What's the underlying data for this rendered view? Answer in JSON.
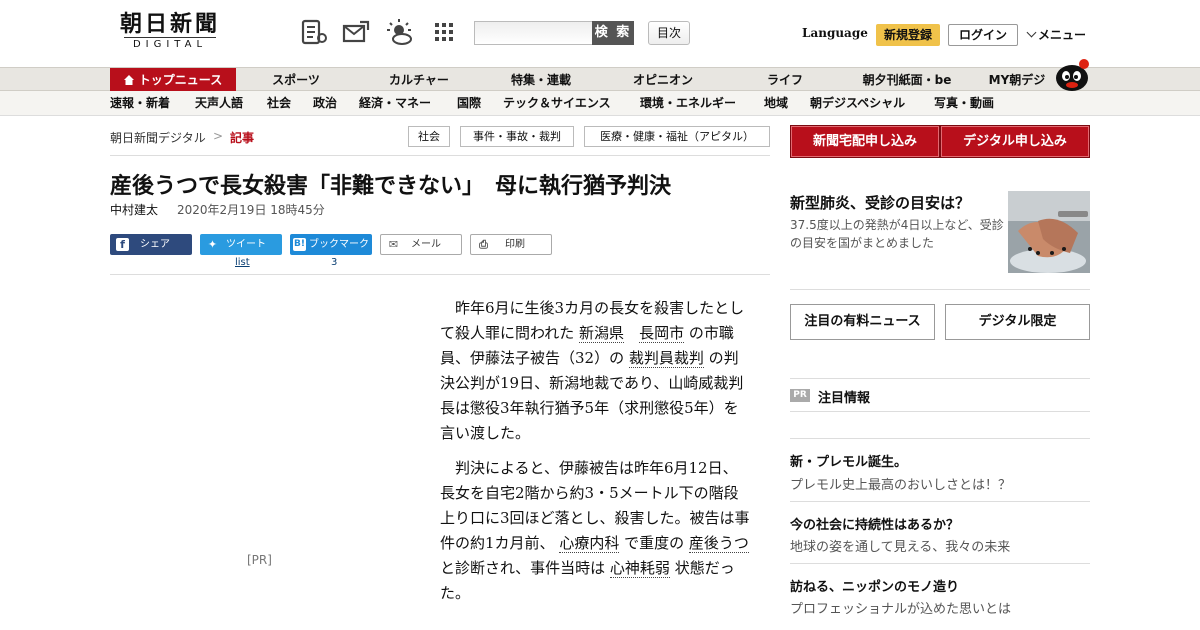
{
  "header": {
    "logo_main": "朝日新聞",
    "logo_sub": "DIGITAL",
    "icons": [
      "paper-icon",
      "mail-icon",
      "weather-icon",
      "grid-icon"
    ],
    "search_placeholder": "",
    "search_button": "検 索",
    "toc_button": "目次",
    "language": "Language",
    "register": "新規登録",
    "login": "ログイン",
    "menu": "メニュー"
  },
  "main_nav": [
    "トップニュース",
    "スポーツ",
    "カルチャー",
    "特集・連載",
    "オピニオン",
    "ライフ",
    "朝夕刊紙面・be",
    "MY朝デジ"
  ],
  "sub_nav": [
    "速報・新着",
    "天声人語",
    "社会",
    "政治",
    "経済・マネー",
    "国際",
    "テック＆サイエンス",
    "環境・エネルギー",
    "地域",
    "朝デジスペシャル",
    "写真・動画"
  ],
  "breadcrumb": {
    "home": "朝日新聞デジタル",
    "sep": ">",
    "current": "記事"
  },
  "tags": [
    "社会",
    "事件・事故・裁判",
    "医療・健康・福祉（アピタル）"
  ],
  "article": {
    "headline": "産後うつで長女殺害「非難できない」　母に執行猶予判決",
    "author": "中村建太",
    "datetime": "2020年2月19日 18時45分",
    "share": {
      "facebook": "シェア",
      "twitter": "ツイート",
      "twitter_count": "list",
      "hatena": "ブックマーク",
      "hatena_count": "3",
      "mail": "メール",
      "print": "印刷"
    },
    "pr_tag": "[PR]",
    "p1": [
      {
        "t": "昨年6月に生後3カ月の長女を殺害したとして殺人罪に問われた "
      },
      {
        "t": "新潟県",
        "link": true
      },
      {
        "t": "　"
      },
      {
        "t": "長岡市",
        "link": true
      },
      {
        "t": " の市職員、伊藤法子被告（32）の "
      },
      {
        "t": "裁判員裁判",
        "link": true
      },
      {
        "t": " の判決公判が19日、新潟地裁であり、山崎威裁判長は懲役3年執行猶予5年（求刑懲役5年）を言い渡した。"
      }
    ],
    "p2": [
      {
        "t": "判決によると、伊藤被告は昨年6月12日、長女を自宅2階から約3・5メートル下の階段上り口に3回ほど落とし、殺害した。被告は事件の約1カ月前、 "
      },
      {
        "t": "心療内科",
        "link": true
      },
      {
        "t": " で重度の "
      },
      {
        "t": "産後うつ",
        "link": true
      },
      {
        "t": " と診断され、事件当時は "
      },
      {
        "t": "心神耗弱",
        "link": true
      },
      {
        "t": " 状態だった。"
      }
    ]
  },
  "sidebar": {
    "subscribe_paper": "新聞宅配申し込み",
    "subscribe_digital": "デジタル申し込み",
    "feature_title": "新型肺炎、受診の目安は？",
    "feature_summary": "37.5度以上の発熱が4日以上など、受診の目安を国がまとめました",
    "btn_paid": "注目の有料ニュース",
    "btn_digital": "デジタル限定",
    "pr_label": "PR",
    "pr_heading": "注目情報",
    "pr_items": [
      {
        "title": "新・プレモル誕生。",
        "sub": "プレモル史上最高のおいしさとは！？"
      },
      {
        "title": "今の社会に持続性はあるか？",
        "sub": "地球の姿を通して見える、我々の未来"
      },
      {
        "title": "訪ねる、ニッポンのモノ造り",
        "sub": "プロフェッショナルが込めた思いとは"
      }
    ]
  },
  "colors": {
    "brand_red": "#b80f1b",
    "register_yellow": "#f0c24a",
    "facebook": "#2e4a7d",
    "twitter": "#2a9be0",
    "hatena": "#1e8ad8"
  }
}
